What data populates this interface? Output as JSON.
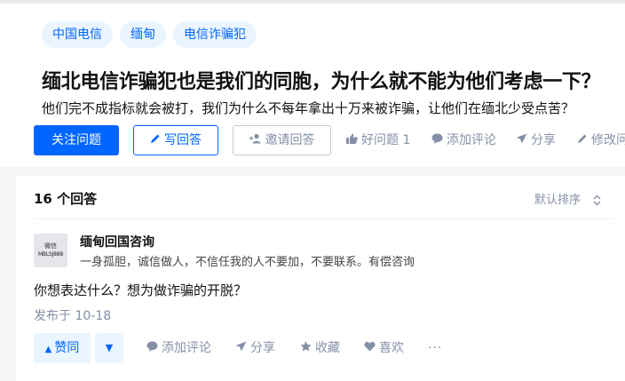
{
  "question": {
    "tags": [
      "中国电信",
      "缅甸",
      "电信诈骗犯"
    ],
    "title": "缅北电信诈骗犯也是我们的同胞，为什么就不能为他们考虑一下？",
    "detail": "他们完不成指标就会被打，我们为什么不每年拿出十万来被诈骗，让他们在缅北少受点苦？",
    "actions": {
      "follow": "关注问题",
      "write": "写回答",
      "invite": "邀请回答",
      "good_question": "好问题 1",
      "comment": "添加评论",
      "share": "分享",
      "edit": "修改问题"
    }
  },
  "answers": {
    "count_label": "16 个回答",
    "sort_label": "默认排序",
    "items": [
      {
        "avatar_text_top": "微信",
        "avatar_text_bottom": "MBLSJ888",
        "author": "缅甸回国咨询",
        "bio": "一身孤胆，诚信做人，不信任我的人不要加，不要联系。有偿咨询",
        "content": "你想表达什么？想为做诈骗的开脱？",
        "date": "发布于 10-18",
        "actions": {
          "upvote": "赞同",
          "comment": "添加评论",
          "share": "分享",
          "collect": "收藏",
          "like": "喜欢",
          "more": "···"
        }
      }
    ]
  },
  "colors": {
    "primary": "#0066ff",
    "tag_bg": "#ebf5ff",
    "muted": "#8590a6"
  }
}
